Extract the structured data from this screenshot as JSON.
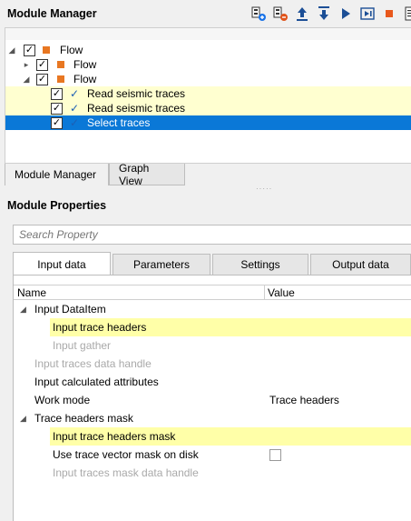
{
  "module_manager": {
    "title": "Module Manager",
    "toolbar": [
      {
        "icon": "add-module-icon",
        "tooltip": ""
      },
      {
        "icon": "remove-module-icon",
        "tooltip": ""
      },
      {
        "icon": "move-up-icon",
        "tooltip": ""
      },
      {
        "icon": "move-down-icon",
        "tooltip": ""
      },
      {
        "icon": "run-icon",
        "tooltip": ""
      },
      {
        "icon": "run-step-icon",
        "tooltip": ""
      },
      {
        "icon": "stop-icon",
        "tooltip": ""
      },
      {
        "icon": "log-icon",
        "tooltip": ""
      }
    ],
    "tree": [
      {
        "label": "Flow",
        "level": 0,
        "expanded": true,
        "checked": true,
        "node": "flow"
      },
      {
        "label": "Flow",
        "level": 1,
        "expanded": false,
        "checked": true,
        "node": "flow"
      },
      {
        "label": "Flow",
        "level": 1,
        "expanded": true,
        "checked": true,
        "node": "flow"
      },
      {
        "label": "Read seismic traces",
        "level": 2,
        "checked": true,
        "node": "module",
        "highlight": "yellow"
      },
      {
        "label": "Read seismic traces",
        "level": 2,
        "checked": true,
        "node": "module",
        "highlight": "yellow"
      },
      {
        "label": "Select traces",
        "level": 2,
        "checked": true,
        "node": "module",
        "highlight": "selected"
      }
    ],
    "tabs": [
      "Module Manager",
      "Graph View"
    ],
    "active_tab": "Module Manager"
  },
  "module_properties": {
    "title": "Module Properties",
    "search_placeholder": "Search Property",
    "tabs": [
      "Input data",
      "Parameters",
      "Settings",
      "Output data"
    ],
    "active_tab": "Input data",
    "columns": [
      "Name",
      "Value"
    ],
    "rows": [
      {
        "name": "Input DataItem",
        "value": "",
        "indent": 1,
        "group": true,
        "expanded": true
      },
      {
        "name": "Input trace headers",
        "value": "",
        "indent": 2,
        "highlight": true
      },
      {
        "name": "Input gather",
        "value": "",
        "indent": 2,
        "disabled": true
      },
      {
        "name": "Input traces data handle",
        "value": "",
        "indent": 1,
        "disabled": true
      },
      {
        "name": "Input calculated attributes",
        "value": "",
        "indent": 1
      },
      {
        "name": "Work mode",
        "value": "Trace headers",
        "indent": 1
      },
      {
        "name": "Trace headers mask",
        "value": "",
        "indent": 1,
        "group": true,
        "expanded": true
      },
      {
        "name": "Input trace headers mask",
        "value": "",
        "indent": 2,
        "highlight": true
      },
      {
        "name": "Use trace vector mask on disk",
        "value": "",
        "indent": 2,
        "checkbox": true,
        "checked": false
      },
      {
        "name": "Input traces mask data handle",
        "value": "",
        "indent": 2,
        "disabled": true
      }
    ]
  },
  "colors": {
    "selection": "#0a78d7",
    "highlight": "#ffffa8",
    "node_orange": "#e87722",
    "check_blue": "#1c5fb3"
  }
}
